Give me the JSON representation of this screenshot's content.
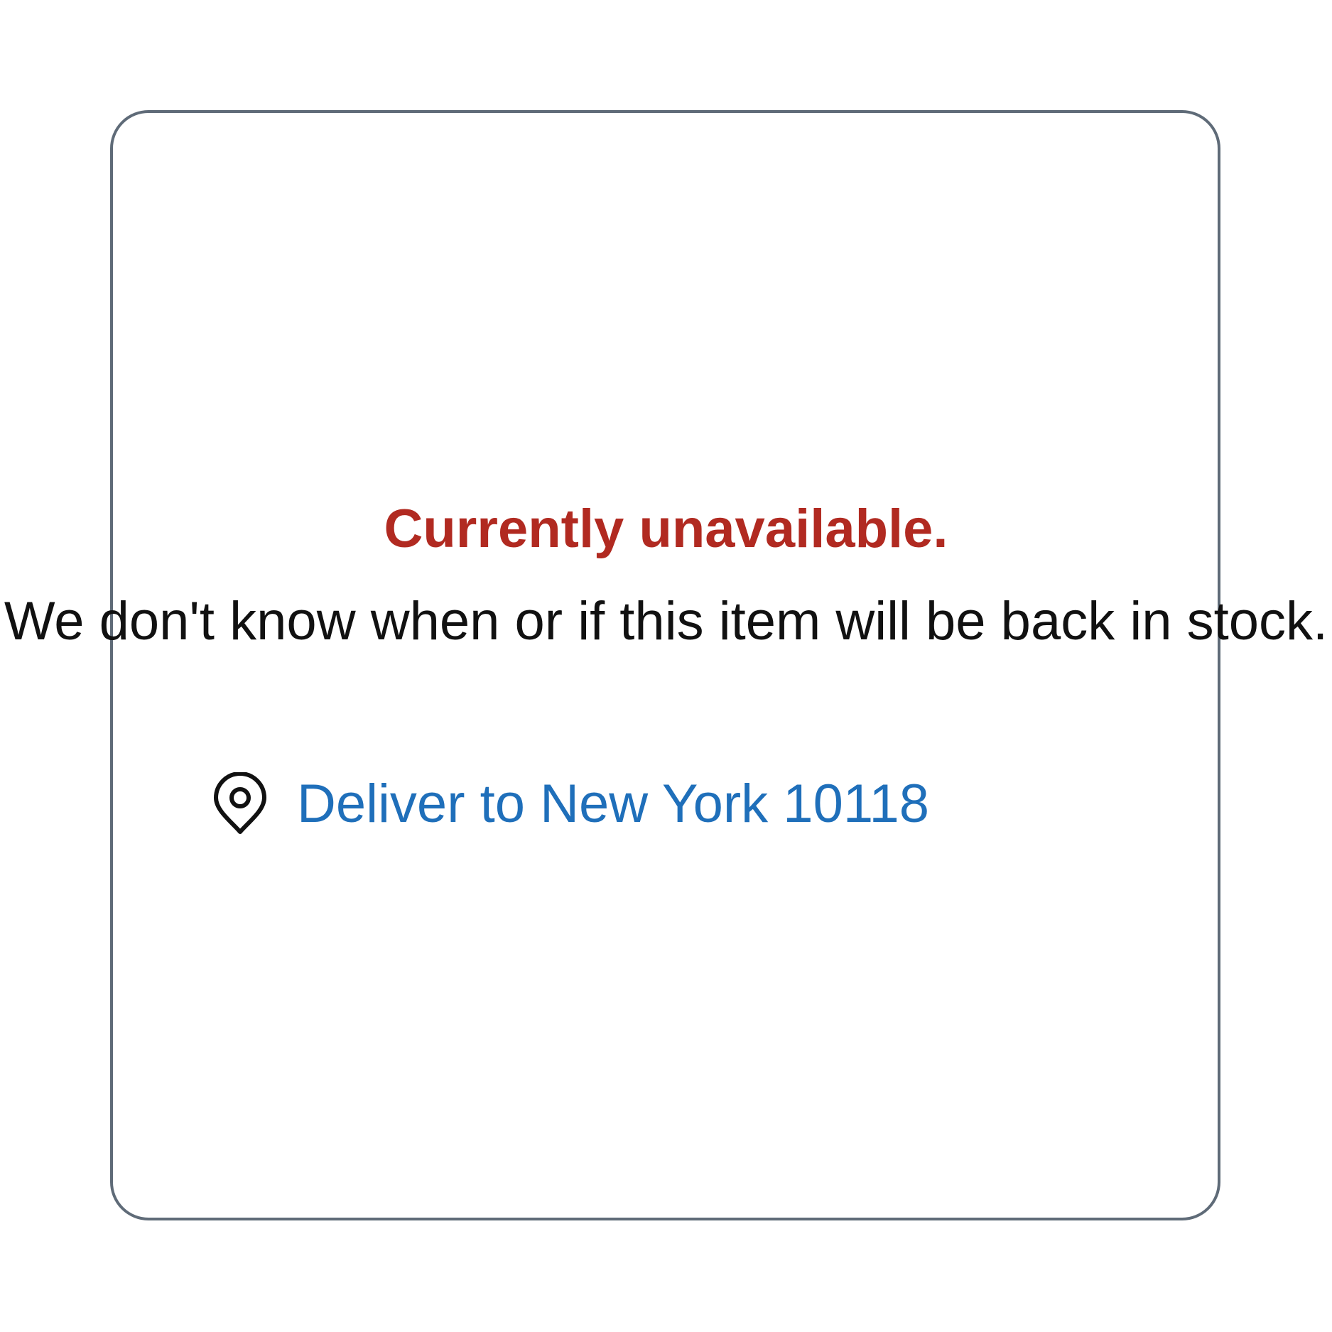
{
  "availability": {
    "status": "Currently unavailable.",
    "message": "We don't know when or if this item will be back in stock."
  },
  "delivery": {
    "icon": "location-pin-icon",
    "link_text": "Deliver to New York 10118"
  },
  "colors": {
    "status": "#b12a21",
    "link": "#1f6fba",
    "border": "#5f6b78"
  }
}
